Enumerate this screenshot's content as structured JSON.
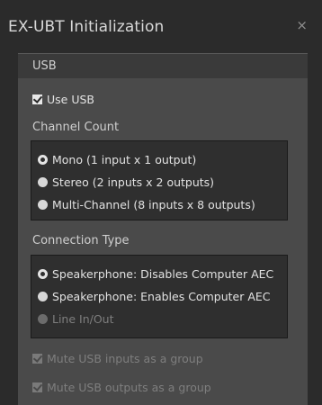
{
  "window": {
    "title": "EX-UBT Initialization",
    "close_icon": "×"
  },
  "panel": {
    "header": "USB",
    "use_usb": {
      "label": "Use USB",
      "checked": true
    },
    "channel_count": {
      "label": "Channel Count",
      "options": [
        {
          "label": "Mono (1 input x 1 output)",
          "selected": true
        },
        {
          "label": "Stereo (2 inputs x 2 outputs)",
          "selected": false
        },
        {
          "label": "Multi-Channel (8 inputs x 8 outputs)",
          "selected": false
        }
      ]
    },
    "connection_type": {
      "label": "Connection Type",
      "options": [
        {
          "label": "Speakerphone: Disables Computer AEC",
          "selected": true
        },
        {
          "label": "Speakerphone: Enables Computer AEC",
          "selected": false
        },
        {
          "label": "Line In/Out",
          "selected": false,
          "disabled": true
        }
      ]
    },
    "mute_inputs": {
      "label": "Mute USB inputs as a group",
      "checked": true,
      "disabled": true
    },
    "mute_outputs": {
      "label": "Mute USB outputs as a group",
      "checked": true,
      "disabled": true
    }
  },
  "colors": {
    "window_bg": "#2b2b2b",
    "panel_bg": "#4a4a4a",
    "group_bg": "#2f2f2f",
    "text": "#e2e2e2",
    "disabled_text": "#7e7e7e"
  }
}
